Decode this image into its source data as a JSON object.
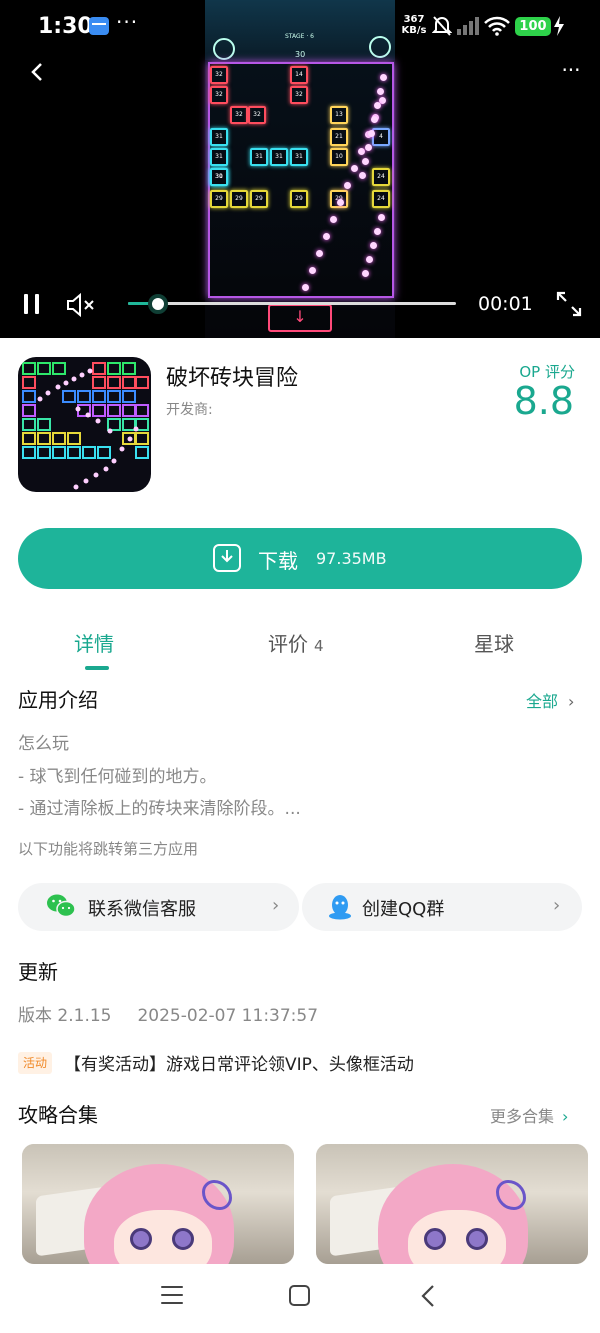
{
  "status_bar": {
    "time": "1:30",
    "dots": "···",
    "net_speed_value": "367",
    "net_speed_unit": "KB/s",
    "battery": "100",
    "icons": [
      "card-icon",
      "bell-mute-icon",
      "signal-icon",
      "wifi-icon",
      "battery-icon",
      "charging-icon"
    ]
  },
  "video": {
    "time": "00:01",
    "progress_fraction": 0.09,
    "game_stage": "STAGE · 6",
    "game_score": "30",
    "brick_values": [
      "32",
      "32",
      "32",
      "14",
      "32",
      "32",
      "13",
      "31",
      "31",
      "31",
      "21",
      "4",
      "31",
      "31",
      "31",
      "10",
      "30",
      "24",
      "29",
      "29",
      "29",
      "29",
      "29",
      "24"
    ]
  },
  "app": {
    "name": "破坏砖块冒险",
    "developer_label": "开发商:",
    "rating_label": "OP 评分",
    "rating_value": "8.8"
  },
  "download": {
    "label": "下载",
    "size": "97.35MB"
  },
  "tabs": [
    {
      "label": "详情",
      "count": ""
    },
    {
      "label": "评价",
      "count": "4"
    },
    {
      "label": "星球",
      "count": ""
    }
  ],
  "intro": {
    "title": "应用介绍",
    "see_all": "全部",
    "lines": [
      "怎么玩",
      "- 球飞到任何碰到的地方。",
      "- 通过清除板上的砖块来清除阶段。..."
    ],
    "third_party_notice": "以下功能将跳转第三方应用"
  },
  "links": {
    "wechat": "联系微信客服",
    "qq": "创建QQ群"
  },
  "update": {
    "title": "更新",
    "version": "版本 2.1.15",
    "date": "2025-02-07 11:37:57",
    "event_badge": "活动",
    "event_text": "【有奖活动】游戏日常评论领VIP、头像框活动"
  },
  "guides": {
    "title": "攻略合集",
    "more": "更多合集"
  },
  "colors": {
    "accent": "#1eb49a",
    "event_orange": "#f08a2a"
  }
}
